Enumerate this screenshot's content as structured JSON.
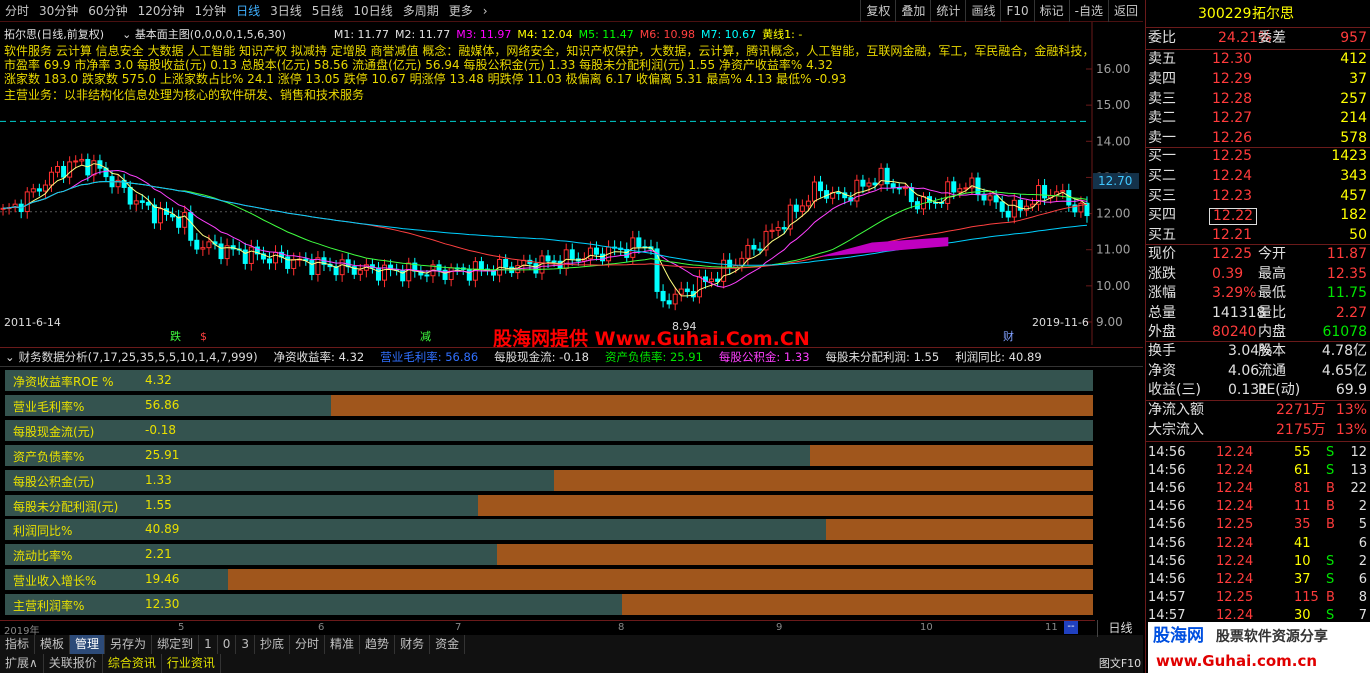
{
  "toolbar": {
    "periods": [
      "分时",
      "30分钟",
      "60分钟",
      "120分钟",
      "1分钟",
      "日线",
      "3日线",
      "5日线",
      "10日线",
      "多周期",
      "更多"
    ],
    "active_index": 5,
    "right": [
      "复权",
      "叠加",
      "统计",
      "画线",
      "F10",
      "标记",
      "-自选",
      "返回"
    ]
  },
  "chart": {
    "title": "拓尔思(日线,前复权)",
    "indicator": "基本面主图(0,0,0,0,1,5,6,30)",
    "ma": [
      {
        "label": "M1: 11.77",
        "color": "#e0e0e0"
      },
      {
        "label": "M2: 11.77",
        "color": "#e0e0e0"
      },
      {
        "label": "M3: 11.97",
        "color": "#ff00ff"
      },
      {
        "label": "M4: 12.04",
        "color": "#ffff00"
      },
      {
        "label": "M5: 11.47",
        "color": "#00ff00"
      },
      {
        "label": "M6: 10.98",
        "color": "#ff4040"
      },
      {
        "label": "M7: 10.67",
        "color": "#00ffff"
      },
      {
        "label": "黄线1: -",
        "color": "#ffff00"
      }
    ],
    "info_lines": [
      "软件服务 云计算 信息安全 大数据 人工智能 知识产权 拟减持 定增股 商誉减值 概念：融媒体，网络安全，知识产权保护，大数据，云计算，腾讯概念，人工智能，互联网金融，军工，军民融合，金融科技，",
      "市盈率 69.9    市净率 3.0    每股收益(元) 0.13    总股本(亿元) 58.56    流通盘(亿元) 56.94    每股公积金(元) 1.33    每股未分配利润(元) 1.55    净资产收益率% 4.32",
      "涨家数 183.0    跌家数 575.0    上涨家数占比% 24.1    涨停 13.05    跌停 10.67    明涨停 13.48    明跌停 11.03    极偏离 6.17    收偏离 5.31    最高% 4.13    最低% -0.93",
      "主营业务：以非结构化信息处理为核心的软件研发、销售和技术服务"
    ],
    "price_ticks": [
      "16.00",
      "15.00",
      "14.00",
      "13.00",
      "12.00",
      "11.00",
      "10.00",
      "9.00"
    ],
    "ylim": [
      9.0,
      16.0
    ],
    "current_price_tag": "12.70",
    "low_label": "8.94",
    "start_date": "2011-6-14",
    "end_date": "2019-11-6",
    "markers": [
      "跌",
      "$",
      "减",
      "财"
    ],
    "watermark": "股海网提供 Www.Guhai.Com.CN"
  },
  "finance": {
    "header_title": "财务数据分析(7,17,25,35,5,5,10,1,4,7,999)",
    "header_items": [
      {
        "label": "净资收益率: 4.32",
        "color": "#e0e0e0"
      },
      {
        "label": "营业毛利率: 56.86",
        "color": "#3070ff"
      },
      {
        "label": "每股现金流: -0.18",
        "color": "#e0e0e0"
      },
      {
        "label": "资产负债率: 25.91",
        "color": "#00e600"
      },
      {
        "label": "每股公积金: 1.33",
        "color": "#ff40ff"
      },
      {
        "label": "每股未分配利润: 1.55",
        "color": "#e0e0e0"
      },
      {
        "label": "利润同比: 40.89",
        "color": "#e0e0e0"
      }
    ],
    "rows": [
      {
        "label": "净资收益率ROE %",
        "value": "4.32",
        "fraction": 1.0
      },
      {
        "label": "营业毛利率%",
        "value": "56.86",
        "fraction": 0.3
      },
      {
        "label": "每股现金流(元)",
        "value": "-0.18",
        "fraction": 1.0
      },
      {
        "label": "资产负债率%",
        "value": "25.91",
        "fraction": 0.74
      },
      {
        "label": "每股公积金(元)",
        "value": "1.33",
        "fraction": 0.505
      },
      {
        "label": "每股未分配利润(元)",
        "value": "1.55",
        "fraction": 0.435
      },
      {
        "label": "利润同比%",
        "value": "40.89",
        "fraction": 0.755
      },
      {
        "label": "流动比率%",
        "value": "2.21",
        "fraction": 0.452
      },
      {
        "label": "营业收入增长%",
        "value": "19.46",
        "fraction": 0.205
      },
      {
        "label": "主营利润率%",
        "value": "12.30",
        "fraction": 0.567
      }
    ]
  },
  "time_axis": [
    "2019年",
    "5",
    "6",
    "7",
    "8",
    "9",
    "10",
    "11"
  ],
  "bottom_tabs": [
    "指标",
    "模板",
    "管理",
    "另存为",
    "绑定到",
    "1",
    "0",
    "3",
    "抄底",
    "分时",
    "精准",
    "趋势",
    "财务",
    "资金"
  ],
  "bottom_tabs2": [
    "扩展∧",
    "关联报价",
    "综合资讯",
    "行业资讯"
  ],
  "bottom_right": [
    "日线",
    "图文F10"
  ],
  "quote": {
    "code": "300229",
    "name": "拓尔思",
    "webi_label": "委比",
    "webi": "24.21%",
    "weicha_label": "委差",
    "weicha": "957",
    "sell": [
      {
        "label": "卖五",
        "price": "12.30",
        "vol": "412"
      },
      {
        "label": "卖四",
        "price": "12.29",
        "vol": "37"
      },
      {
        "label": "卖三",
        "price": "12.28",
        "vol": "257"
      },
      {
        "label": "卖二",
        "price": "12.27",
        "vol": "214"
      },
      {
        "label": "卖一",
        "price": "12.26",
        "vol": "578"
      }
    ],
    "buy": [
      {
        "label": "买一",
        "price": "12.25",
        "vol": "1423"
      },
      {
        "label": "买二",
        "price": "12.24",
        "vol": "343"
      },
      {
        "label": "买三",
        "price": "12.23",
        "vol": "457"
      },
      {
        "label": "买四",
        "price": "12.22",
        "vol": "182"
      },
      {
        "label": "买五",
        "price": "12.21",
        "vol": "50"
      }
    ],
    "stats1": [
      {
        "l1": "现价",
        "v1": "12.25",
        "c1": "red",
        "l2": "今开",
        "v2": "11.87",
        "c2": "red"
      },
      {
        "l1": "涨跌",
        "v1": "0.39",
        "c1": "red",
        "l2": "最高",
        "v2": "12.35",
        "c2": "red"
      },
      {
        "l1": "涨幅",
        "v1": "3.29%",
        "c1": "red",
        "l2": "最低",
        "v2": "11.75",
        "c2": "green"
      },
      {
        "l1": "总量",
        "v1": "141318",
        "c1": "white",
        "l2": "量比",
        "v2": "2.27",
        "c2": "red"
      },
      {
        "l1": "外盘",
        "v1": "80240",
        "c1": "red",
        "l2": "内盘",
        "v2": "61078",
        "c2": "green"
      }
    ],
    "stats2": [
      {
        "l1": "换手",
        "v1": "3.04%",
        "l2": "股本",
        "v2": "4.78亿"
      },
      {
        "l1": "净资",
        "v1": "4.06",
        "l2": "流通",
        "v2": "4.65亿"
      },
      {
        "l1": "收益(三)",
        "v1": "0.131",
        "l2": "PE(动)",
        "v2": "69.9"
      }
    ],
    "flow": [
      {
        "label": "净流入额",
        "value": "2271万",
        "pct": "13%"
      },
      {
        "label": "大宗流入",
        "value": "2175万",
        "pct": "13%"
      }
    ],
    "ticks": [
      {
        "t": "14:56",
        "p": "12.24",
        "v": "55",
        "d": "S",
        "n": "12"
      },
      {
        "t": "14:56",
        "p": "12.24",
        "v": "61",
        "d": "S",
        "n": "13"
      },
      {
        "t": "14:56",
        "p": "12.24",
        "v": "81",
        "d": "B",
        "n": "22"
      },
      {
        "t": "14:56",
        "p": "12.24",
        "v": "11",
        "d": "B",
        "n": "2"
      },
      {
        "t": "14:56",
        "p": "12.25",
        "v": "35",
        "d": "B",
        "n": "5"
      },
      {
        "t": "14:56",
        "p": "12.24",
        "v": "41",
        "d": "",
        "n": "6"
      },
      {
        "t": "14:56",
        "p": "12.24",
        "v": "10",
        "d": "S",
        "n": "2"
      },
      {
        "t": "14:56",
        "p": "12.24",
        "v": "37",
        "d": "S",
        "n": "6"
      },
      {
        "t": "14:57",
        "p": "12.25",
        "v": "115",
        "d": "B",
        "n": "8"
      },
      {
        "t": "14:57",
        "p": "12.24",
        "v": "30",
        "d": "S",
        "n": "7"
      }
    ]
  },
  "logo": {
    "brand": "股海网",
    "slogan": "股票软件资源分享",
    "url": "www.Guhai.com.cn"
  }
}
